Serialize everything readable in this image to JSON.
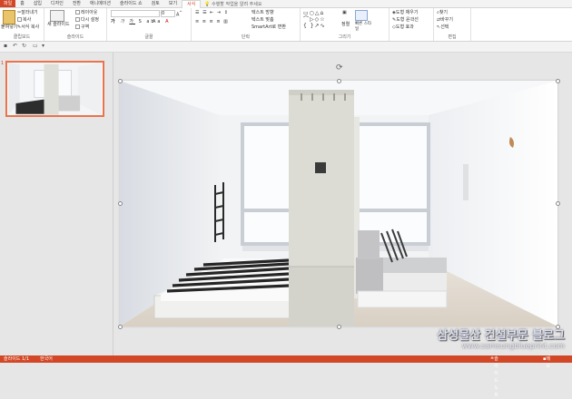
{
  "tabs": [
    "파일",
    "홈",
    "삽입",
    "디자인",
    "전환",
    "애니메이션",
    "슬라이드 쇼",
    "검토",
    "보기",
    "서식"
  ],
  "tell_me": "수행할 작업을 알려 주세요",
  "ribbon": {
    "clipboard": {
      "paste": "붙여넣기",
      "cut": "잘라내기",
      "copy": "복사",
      "format": "서식 복사",
      "label": "클립보드"
    },
    "slides": {
      "new": "새 슬라이드",
      "layout": "레이아웃",
      "reset": "다시 설정",
      "section": "구역",
      "label": "슬라이드"
    },
    "font": {
      "label": "글꼴",
      "size": "0"
    },
    "paragraph": {
      "direction": "텍스트 방향",
      "align": "텍스트 맞춤",
      "smartart": "SmartArt로 변환",
      "label": "단락"
    },
    "drawing": {
      "arrange": "정렬",
      "quick": "빠른 스타일",
      "fill": "도형 채우기",
      "outline": "도형 윤곽선",
      "effect": "도형 효과",
      "label": "그리기"
    },
    "editing": {
      "find": "찾기",
      "replace": "바꾸기",
      "select": "선택",
      "label": "편집"
    }
  },
  "slide_number": "1",
  "watermark": {
    "title": "삼성물산 건설부문 블로그",
    "url": "www.samsungblueprint.com"
  },
  "status": {
    "slide": "슬라이드 1/1",
    "lang": "한국어",
    "notes": "슬라이드 노트",
    "comments": "메모"
  }
}
